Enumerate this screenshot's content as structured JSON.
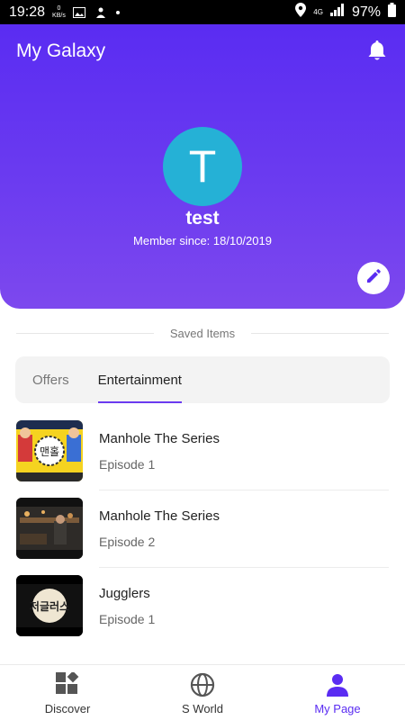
{
  "status_bar": {
    "time": "19:28",
    "data_rate_value": "0",
    "data_rate_unit": "KB/s",
    "network": "4G",
    "battery": "97%"
  },
  "header": {
    "app_title": "My Galaxy",
    "avatar_letter": "T",
    "username": "test",
    "member_since": "Member since: 18/10/2019"
  },
  "saved": {
    "label": "Saved Items"
  },
  "tabs": [
    {
      "label": "Offers",
      "active": false
    },
    {
      "label": "Entertainment",
      "active": true
    }
  ],
  "items": [
    {
      "title": "Manhole The Series",
      "subtitle": "Episode 1"
    },
    {
      "title": "Manhole The Series",
      "subtitle": "Episode 2"
    },
    {
      "title": "Jugglers",
      "subtitle": "Episode 1"
    }
  ],
  "bottom_nav": [
    {
      "label": "Discover",
      "icon": "discover-icon"
    },
    {
      "label": "S World",
      "icon": "globe-icon"
    },
    {
      "label": "My Page",
      "icon": "person-icon",
      "active": true
    }
  ],
  "colors": {
    "brand": "#5a2cf2",
    "avatar": "#25b1d6"
  }
}
